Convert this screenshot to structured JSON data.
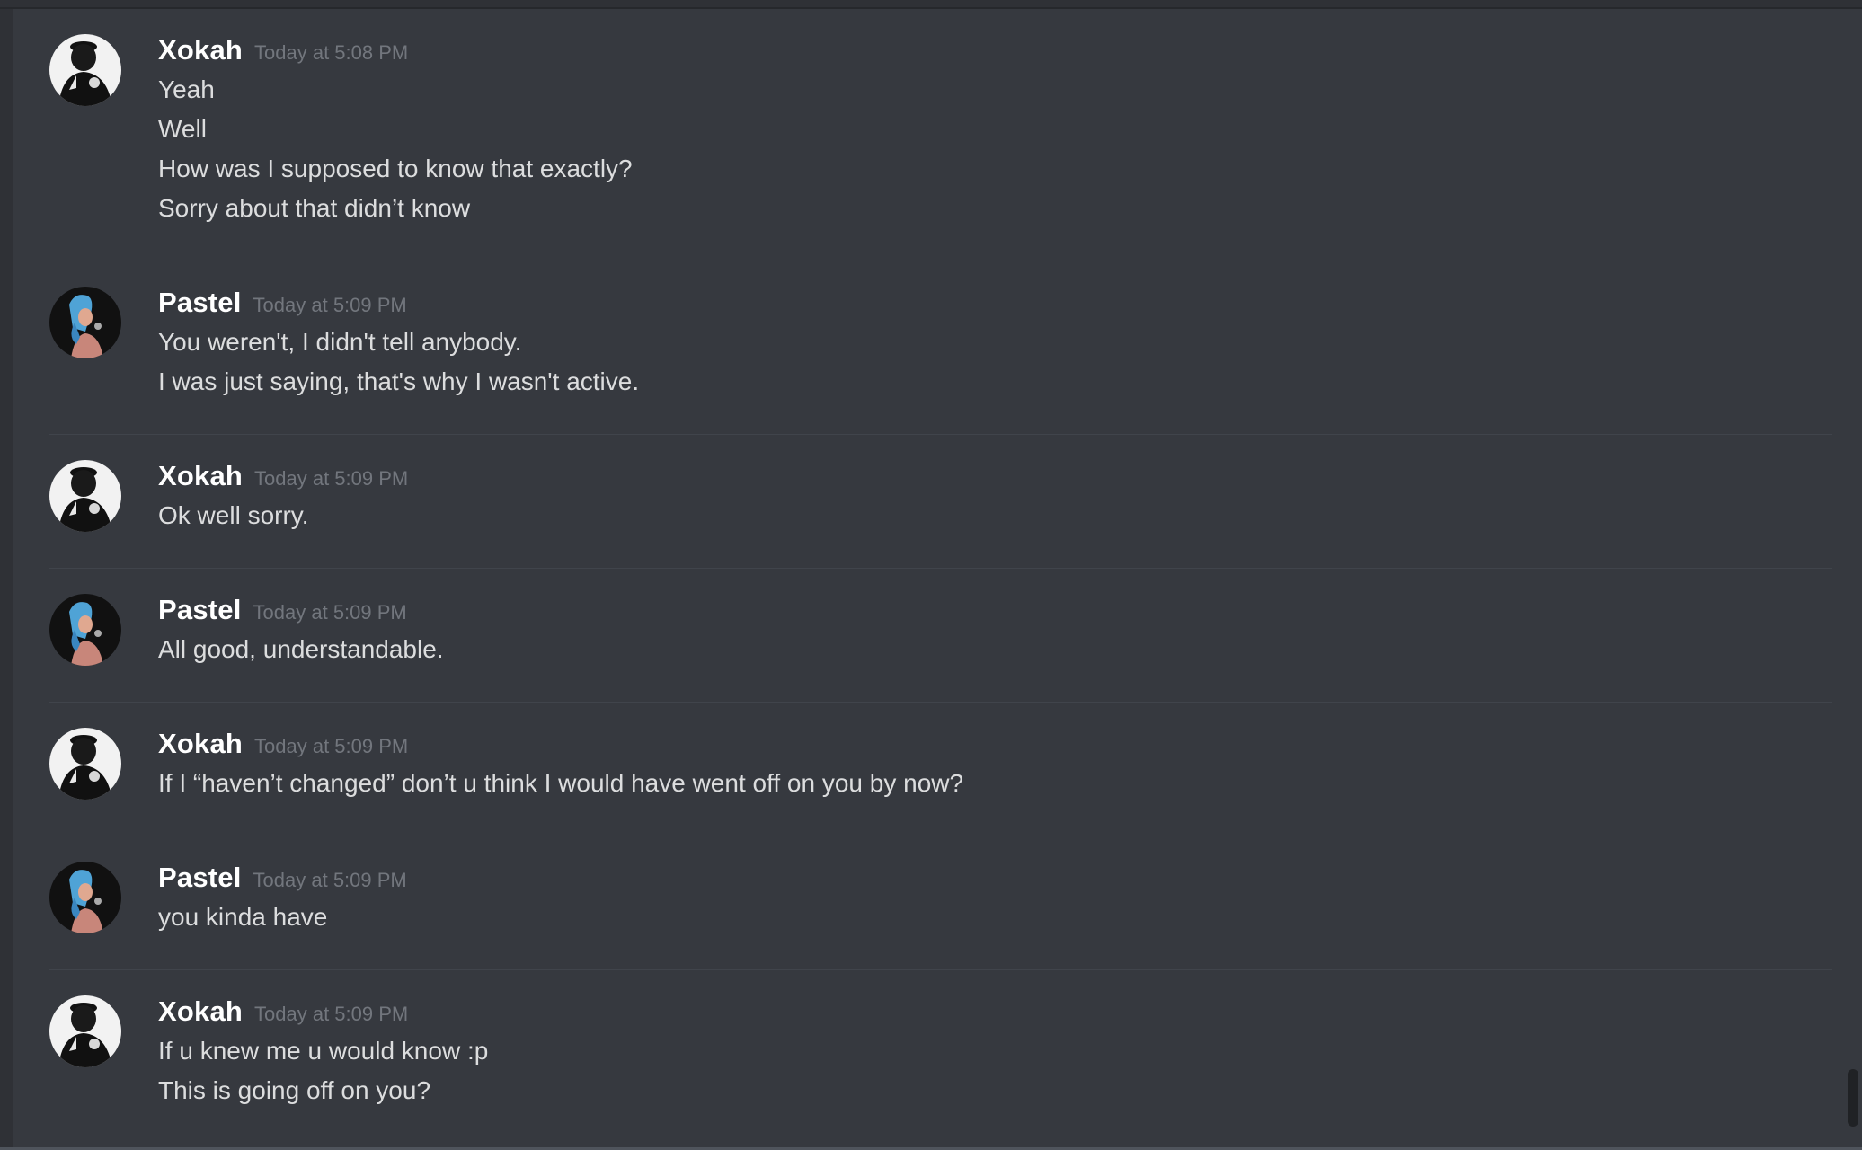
{
  "colors": {
    "background": "#36393f",
    "username": "#ffffff",
    "timestamp": "#72767d",
    "text": "#dcddde",
    "divider": "#40444b"
  },
  "messages": [
    {
      "author": "Xokah",
      "avatar_icon": "xokah-avatar-icon",
      "timestamp": "Today at 5:08 PM",
      "lines": [
        "Yeah",
        "Well",
        "How was I supposed to know that exactly?",
        "Sorry about that didn’t know"
      ]
    },
    {
      "author": "Pastel",
      "avatar_icon": "pastel-avatar-icon",
      "timestamp": "Today at 5:09 PM",
      "lines": [
        "You weren't, I didn't tell anybody.",
        "I was just saying, that's why I wasn't active."
      ]
    },
    {
      "author": "Xokah",
      "avatar_icon": "xokah-avatar-icon",
      "timestamp": "Today at 5:09 PM",
      "lines": [
        "Ok well sorry."
      ]
    },
    {
      "author": "Pastel",
      "avatar_icon": "pastel-avatar-icon",
      "timestamp": "Today at 5:09 PM",
      "lines": [
        "All good, understandable."
      ]
    },
    {
      "author": "Xokah",
      "avatar_icon": "xokah-avatar-icon",
      "timestamp": "Today at 5:09 PM",
      "lines": [
        "If I “haven’t changed” don’t u think I would have went off on you by now?"
      ]
    },
    {
      "author": "Pastel",
      "avatar_icon": "pastel-avatar-icon",
      "timestamp": "Today at 5:09 PM",
      "lines": [
        "you kinda have"
      ]
    },
    {
      "author": "Xokah",
      "avatar_icon": "xokah-avatar-icon",
      "timestamp": "Today at 5:09 PM",
      "lines": [
        "If u knew me u would know :p",
        "This is going off on you?"
      ]
    }
  ]
}
